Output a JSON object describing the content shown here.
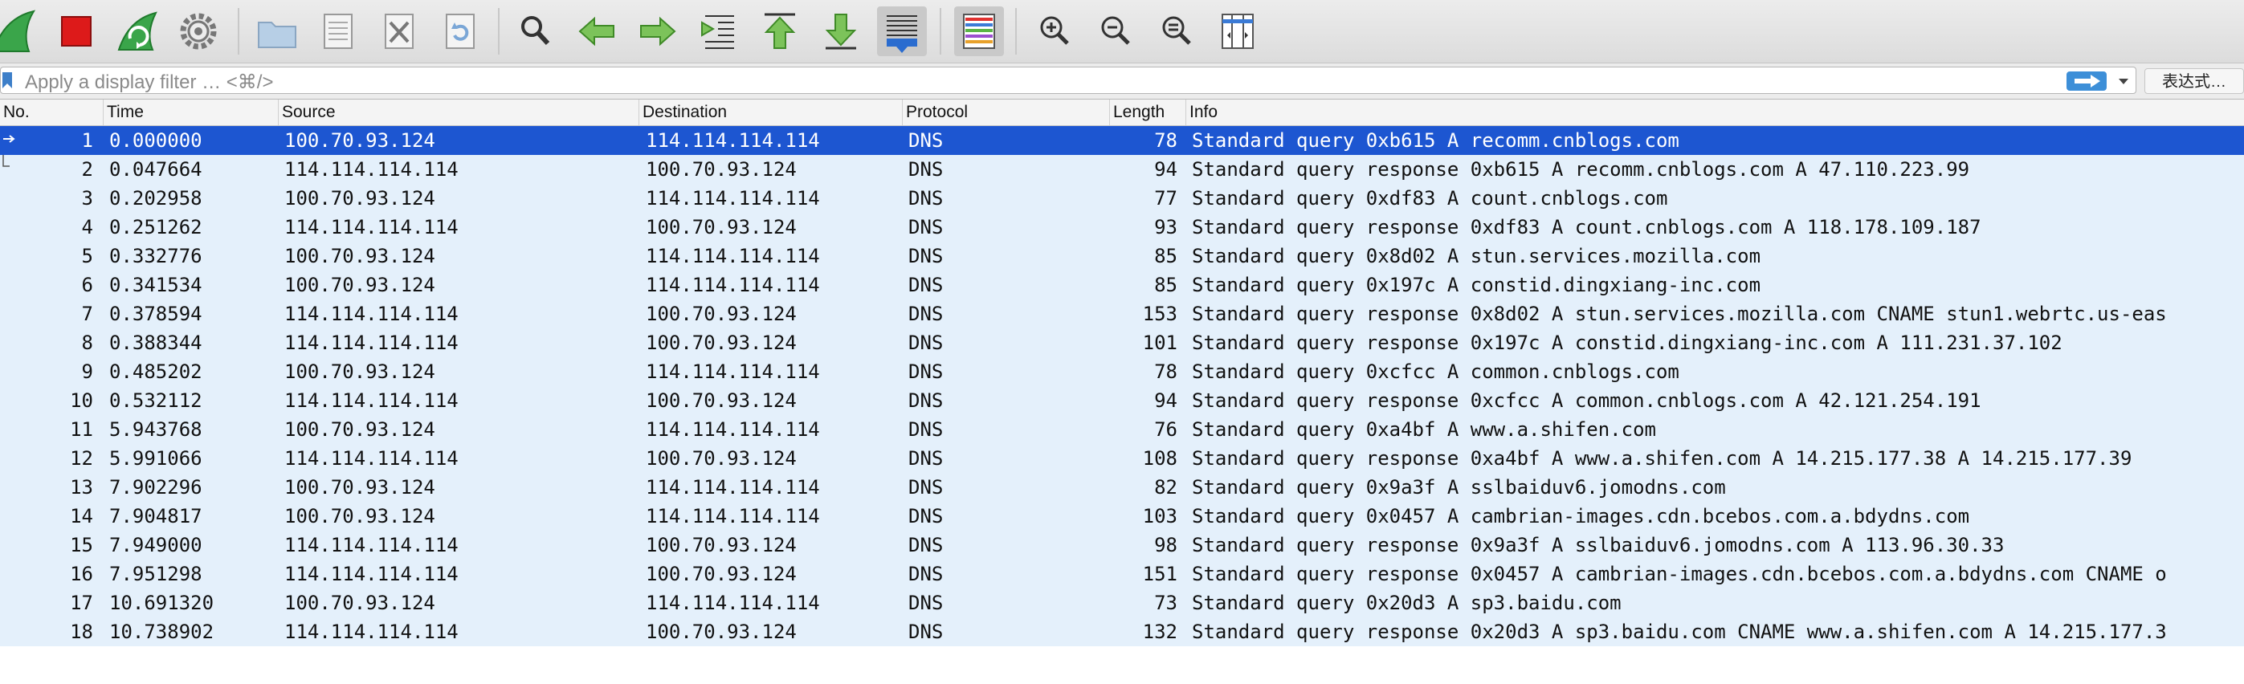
{
  "toolbar": {
    "buttons": [
      "start-capture",
      "stop-capture",
      "restart-capture",
      "capture-options",
      "open-file",
      "save-file",
      "close-file",
      "reload-file",
      "find-packet",
      "go-back",
      "go-forward",
      "go-to-packet",
      "go-first",
      "go-last",
      "auto-scroll",
      "colorize",
      "zoom-in",
      "zoom-out",
      "zoom-normal",
      "resize-columns"
    ]
  },
  "filter": {
    "placeholder": "Apply a display filter … <⌘/>",
    "expression_label": "表达式…"
  },
  "columns": {
    "no": "No.",
    "time": "Time",
    "source": "Source",
    "destination": "Destination",
    "protocol": "Protocol",
    "length": "Length",
    "info": "Info"
  },
  "packets": [
    {
      "no": "1",
      "time": "0.000000",
      "source": "100.70.93.124",
      "destination": "114.114.114.114",
      "protocol": "DNS",
      "length": "78",
      "info": "Standard query 0xb615 A recomm.cnblogs.com"
    },
    {
      "no": "2",
      "time": "0.047664",
      "source": "114.114.114.114",
      "destination": "100.70.93.124",
      "protocol": "DNS",
      "length": "94",
      "info": "Standard query response 0xb615 A recomm.cnblogs.com A 47.110.223.99"
    },
    {
      "no": "3",
      "time": "0.202958",
      "source": "100.70.93.124",
      "destination": "114.114.114.114",
      "protocol": "DNS",
      "length": "77",
      "info": "Standard query 0xdf83 A count.cnblogs.com"
    },
    {
      "no": "4",
      "time": "0.251262",
      "source": "114.114.114.114",
      "destination": "100.70.93.124",
      "protocol": "DNS",
      "length": "93",
      "info": "Standard query response 0xdf83 A count.cnblogs.com A 118.178.109.187"
    },
    {
      "no": "5",
      "time": "0.332776",
      "source": "100.70.93.124",
      "destination": "114.114.114.114",
      "protocol": "DNS",
      "length": "85",
      "info": "Standard query 0x8d02 A stun.services.mozilla.com"
    },
    {
      "no": "6",
      "time": "0.341534",
      "source": "100.70.93.124",
      "destination": "114.114.114.114",
      "protocol": "DNS",
      "length": "85",
      "info": "Standard query 0x197c A constid.dingxiang-inc.com"
    },
    {
      "no": "7",
      "time": "0.378594",
      "source": "114.114.114.114",
      "destination": "100.70.93.124",
      "protocol": "DNS",
      "length": "153",
      "info": "Standard query response 0x8d02 A stun.services.mozilla.com CNAME stun1.webrtc.us-eas"
    },
    {
      "no": "8",
      "time": "0.388344",
      "source": "114.114.114.114",
      "destination": "100.70.93.124",
      "protocol": "DNS",
      "length": "101",
      "info": "Standard query response 0x197c A constid.dingxiang-inc.com A 111.231.37.102"
    },
    {
      "no": "9",
      "time": "0.485202",
      "source": "100.70.93.124",
      "destination": "114.114.114.114",
      "protocol": "DNS",
      "length": "78",
      "info": "Standard query 0xcfcc A common.cnblogs.com"
    },
    {
      "no": "10",
      "time": "0.532112",
      "source": "114.114.114.114",
      "destination": "100.70.93.124",
      "protocol": "DNS",
      "length": "94",
      "info": "Standard query response 0xcfcc A common.cnblogs.com A 42.121.254.191"
    },
    {
      "no": "11",
      "time": "5.943768",
      "source": "100.70.93.124",
      "destination": "114.114.114.114",
      "protocol": "DNS",
      "length": "76",
      "info": "Standard query 0xa4bf A www.a.shifen.com"
    },
    {
      "no": "12",
      "time": "5.991066",
      "source": "114.114.114.114",
      "destination": "100.70.93.124",
      "protocol": "DNS",
      "length": "108",
      "info": "Standard query response 0xa4bf A www.a.shifen.com A 14.215.177.38 A 14.215.177.39"
    },
    {
      "no": "13",
      "time": "7.902296",
      "source": "100.70.93.124",
      "destination": "114.114.114.114",
      "protocol": "DNS",
      "length": "82",
      "info": "Standard query 0x9a3f A sslbaiduv6.jomodns.com"
    },
    {
      "no": "14",
      "time": "7.904817",
      "source": "100.70.93.124",
      "destination": "114.114.114.114",
      "protocol": "DNS",
      "length": "103",
      "info": "Standard query 0x0457 A cambrian-images.cdn.bcebos.com.a.bdydns.com"
    },
    {
      "no": "15",
      "time": "7.949000",
      "source": "114.114.114.114",
      "destination": "100.70.93.124",
      "protocol": "DNS",
      "length": "98",
      "info": "Standard query response 0x9a3f A sslbaiduv6.jomodns.com A 113.96.30.33"
    },
    {
      "no": "16",
      "time": "7.951298",
      "source": "114.114.114.114",
      "destination": "100.70.93.124",
      "protocol": "DNS",
      "length": "151",
      "info": "Standard query response 0x0457 A cambrian-images.cdn.bcebos.com.a.bdydns.com CNAME o"
    },
    {
      "no": "17",
      "time": "10.691320",
      "source": "100.70.93.124",
      "destination": "114.114.114.114",
      "protocol": "DNS",
      "length": "73",
      "info": "Standard query 0x20d3 A sp3.baidu.com"
    },
    {
      "no": "18",
      "time": "10.738902",
      "source": "114.114.114.114",
      "destination": "100.70.93.124",
      "protocol": "DNS",
      "length": "132",
      "info": "Standard query response 0x20d3 A sp3.baidu.com CNAME www.a.shifen.com A 14.215.177.3"
    }
  ],
  "selected_row": 0,
  "colors": {
    "row_background": "#e4f0fb",
    "selected_background": "#1d56d1",
    "apply_button": "#3d8fd8"
  }
}
